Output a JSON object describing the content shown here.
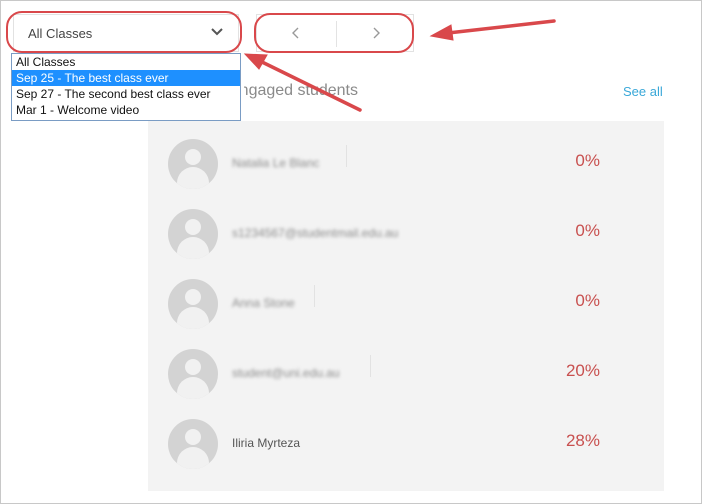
{
  "class_select": {
    "value": "All Classes",
    "options": [
      "All Classes",
      "Sep 25 - The best class ever",
      "Sep 27 - The second best class ever",
      "Mar 1 - Welcome video"
    ],
    "highlighted_index": 1
  },
  "pager": {
    "prev_icon": "chevron-left-icon",
    "next_icon": "chevron-right-icon"
  },
  "section": {
    "title": "Engaged students",
    "see_all": "See all"
  },
  "students": [
    {
      "name": "Natalia Le Blanc",
      "percent": "0%",
      "blurred": true
    },
    {
      "name": "s1234567@studentmail.edu.au",
      "percent": "0%",
      "blurred": true
    },
    {
      "name": "Anna Stone",
      "percent": "0%",
      "blurred": true
    },
    {
      "name": "student@uni.edu.au",
      "percent": "20%",
      "blurred": true
    },
    {
      "name": "Iliria Myrteza",
      "percent": "28%",
      "blurred": false
    }
  ],
  "colors": {
    "annotation": "#d9484b",
    "percent": "#c8504f",
    "link": "#3aa8d8",
    "selected_option": "#1e90ff"
  }
}
